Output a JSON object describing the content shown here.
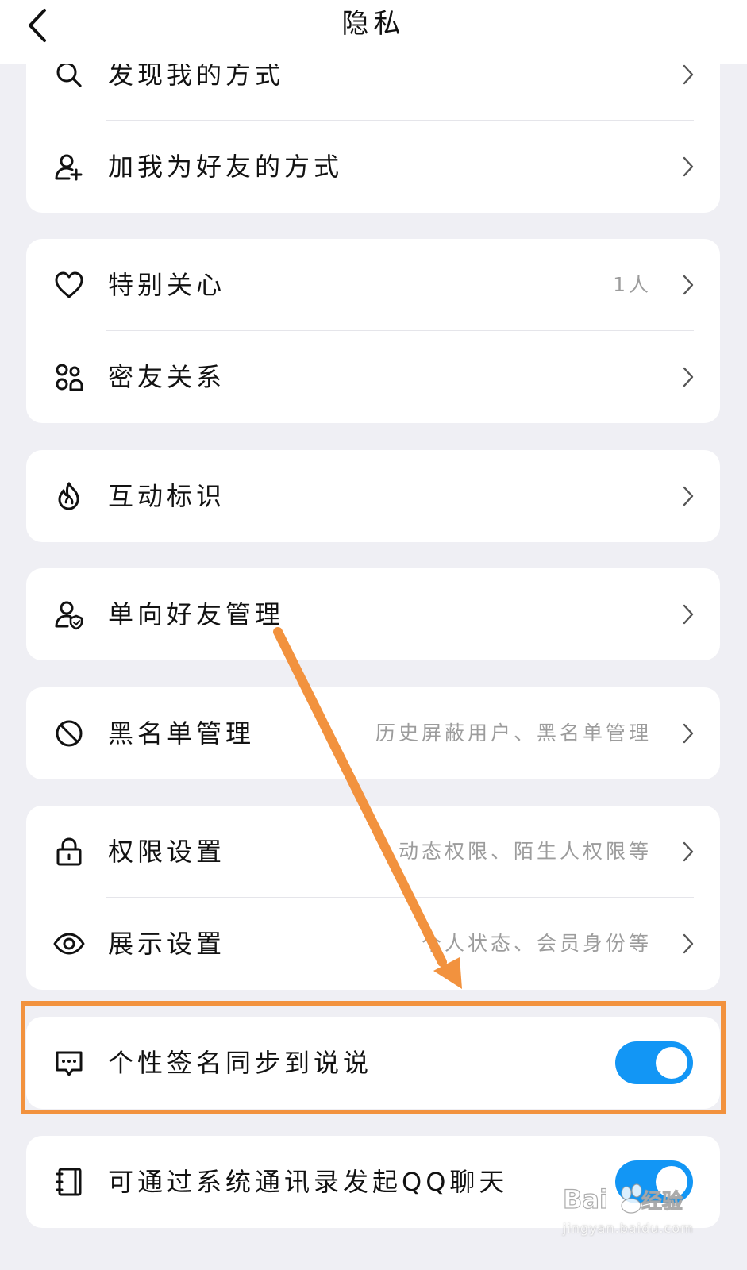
{
  "header": {
    "title": "隐私",
    "back_icon": "chevron-left-icon"
  },
  "groups": [
    {
      "rows": [
        {
          "label": "发现我的方式",
          "icon": "search-icon"
        },
        {
          "label": "加我为好友的方式",
          "icon": "add-user-icon"
        }
      ]
    },
    {
      "rows": [
        {
          "label": "特别关心",
          "value": "1人",
          "icon": "heart-icon"
        },
        {
          "label": "密友关系",
          "icon": "close-friends-icon"
        }
      ]
    },
    {
      "rows": [
        {
          "label": "互动标识",
          "icon": "flame-icon"
        }
      ]
    },
    {
      "rows": [
        {
          "label": "单向好友管理",
          "icon": "user-shield-icon"
        }
      ]
    },
    {
      "rows": [
        {
          "label": "黑名单管理",
          "value": "历史屏蔽用户、黑名单管理",
          "icon": "block-icon"
        }
      ]
    },
    {
      "rows": [
        {
          "label": "权限设置",
          "value": "动态权限、陌生人权限等",
          "icon": "lock-icon"
        },
        {
          "label": "展示设置",
          "value": "个人状态、会员身份等",
          "icon": "eye-icon"
        }
      ]
    },
    {
      "rows": [
        {
          "label": "个性签名同步到说说",
          "icon": "message-icon",
          "toggle_on": true
        }
      ]
    },
    {
      "rows": [
        {
          "label": "可通过系统通讯录发起QQ聊天",
          "icon": "contacts-book-icon",
          "toggle_on": true
        }
      ]
    }
  ],
  "colors": {
    "toggle_on": "#1296f5",
    "annotation": "#f2923e",
    "background": "#efeff4"
  },
  "watermark": {
    "brand": "Baidu经验",
    "url": "jingyan.baidu.com"
  }
}
